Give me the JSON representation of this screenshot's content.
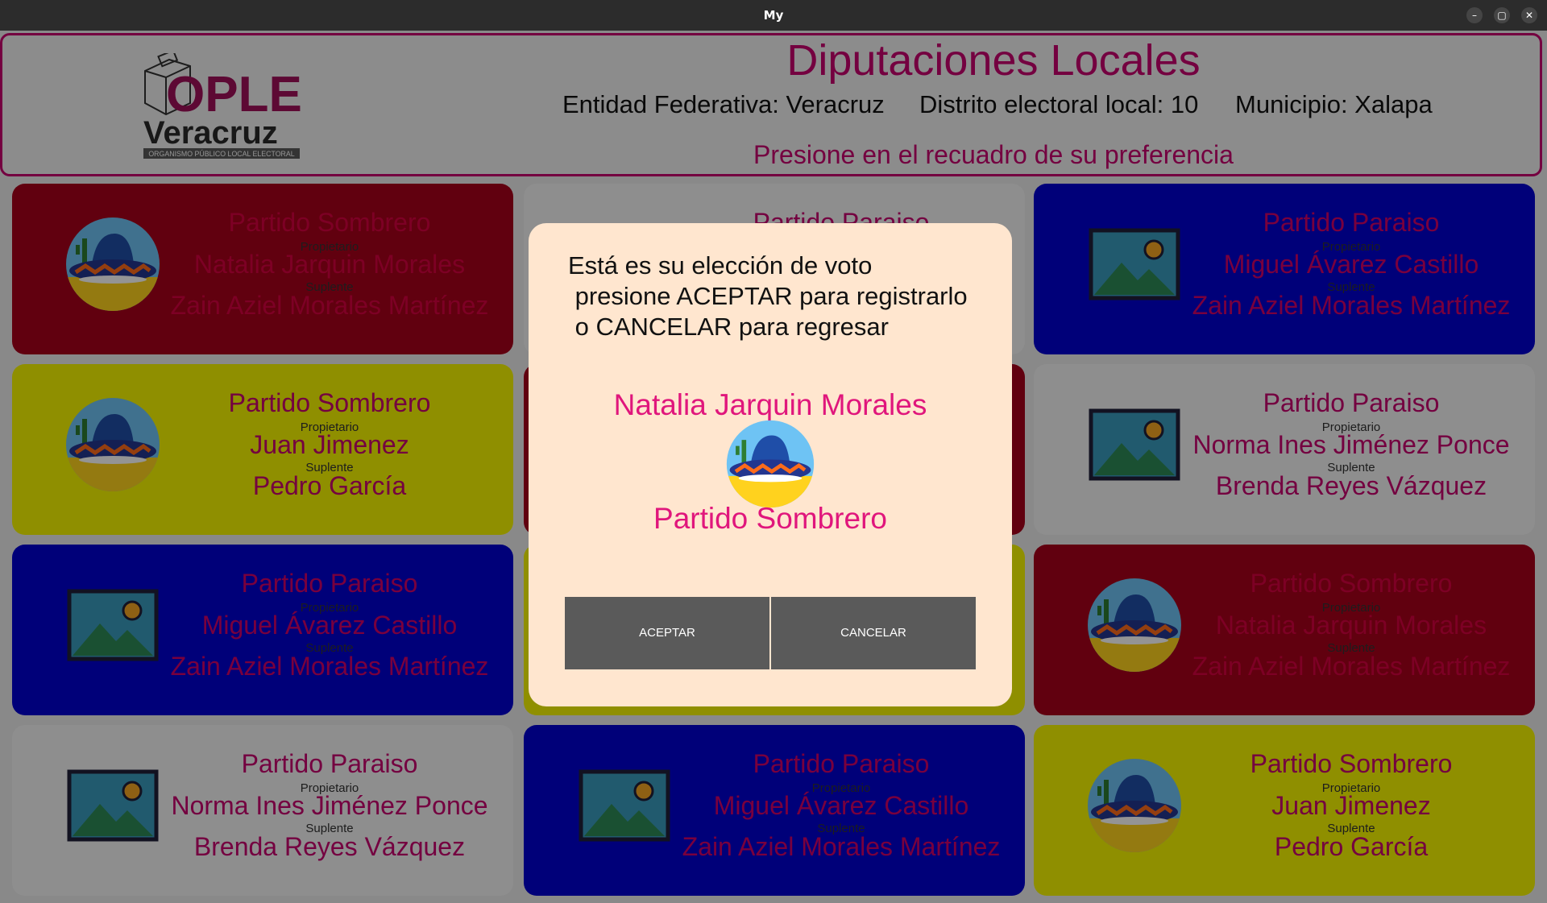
{
  "window": {
    "title": "My",
    "controls": {
      "minimize": "–",
      "maximize": "▢",
      "close": "✕"
    }
  },
  "header": {
    "logo": {
      "brand": "OPLE",
      "region": "Veracruz",
      "subtitle": "ORGANISMO PÚBLICO LOCAL ELECTORAL"
    },
    "title": "Diputaciones Locales",
    "entidad": "Entidad Federativa: Veracruz",
    "distrito": "Distrito electoral local: 10",
    "municipio": "Municipio: Xalapa",
    "instruction": "Presione en el recuadro de su preferencia"
  },
  "labels": {
    "propietario": "Propietario",
    "suplente": "Suplente"
  },
  "cards": [
    {
      "color": "#a8001a",
      "party": "Partido Sombrero",
      "propietario": "Natalia Jarquin Morales",
      "suplente": "Zain Aziel Morales Martínez",
      "image": "sombrero-icon"
    },
    {
      "color": "#f4f4f4",
      "party": "Partido Paraiso",
      "propietario": "",
      "suplente": "",
      "image": "image-placeholder-icon"
    },
    {
      "color": "#0000d0",
      "party": "Partido Paraiso",
      "propietario": "Miguel Ávarez Castillo",
      "suplente": "Zain Aziel Morales Martínez",
      "image": "image-placeholder-icon"
    },
    {
      "color": "#f7f700",
      "party": "Partido Sombrero",
      "propietario": "Juan Jimenez",
      "suplente": "Pedro García",
      "image": "sombrero-icon"
    },
    {
      "color": "#a8001a",
      "party": "",
      "propietario": "",
      "suplente": "",
      "image": ""
    },
    {
      "color": "#f4f4f4",
      "party": "Partido Paraiso",
      "propietario": "Norma Ines Jiménez Ponce",
      "suplente": "Brenda Reyes Vázquez",
      "image": "image-placeholder-icon"
    },
    {
      "color": "#0000d0",
      "party": "Partido Paraiso",
      "propietario": "Miguel Ávarez Castillo",
      "suplente": "Zain Aziel Morales Martínez",
      "image": "image-placeholder-icon"
    },
    {
      "color": "#f7f700",
      "party": "",
      "propietario": "",
      "suplente": "",
      "image": ""
    },
    {
      "color": "#a8001a",
      "party": "Partido Sombrero",
      "propietario": "Natalia Jarquin Morales",
      "suplente": "Zain Aziel Morales Martínez",
      "image": "sombrero-icon"
    },
    {
      "color": "#f4f4f4",
      "party": "Partido Paraiso",
      "propietario": "Norma Ines Jiménez Ponce",
      "suplente": "Brenda Reyes Vázquez",
      "image": "image-placeholder-icon"
    },
    {
      "color": "#0000d0",
      "party": "Partido Paraiso",
      "propietario": "Miguel Ávarez Castillo",
      "suplente": "Zain Aziel Morales Martínez",
      "image": "image-placeholder-icon"
    },
    {
      "color": "#f7f700",
      "party": "Partido Sombrero",
      "propietario": "Juan Jimenez",
      "suplente": "Pedro García",
      "image": "sombrero-icon"
    }
  ],
  "dialog": {
    "message": "Está es su elección de voto\n presione ACEPTAR para registrarlo\n o CANCELAR para regresar",
    "candidate": "Natalia Jarquin Morales",
    "party": "Partido Sombrero",
    "image": "sombrero-icon",
    "accept_label": "ACEPTAR",
    "cancel_label": "CANCELAR"
  }
}
